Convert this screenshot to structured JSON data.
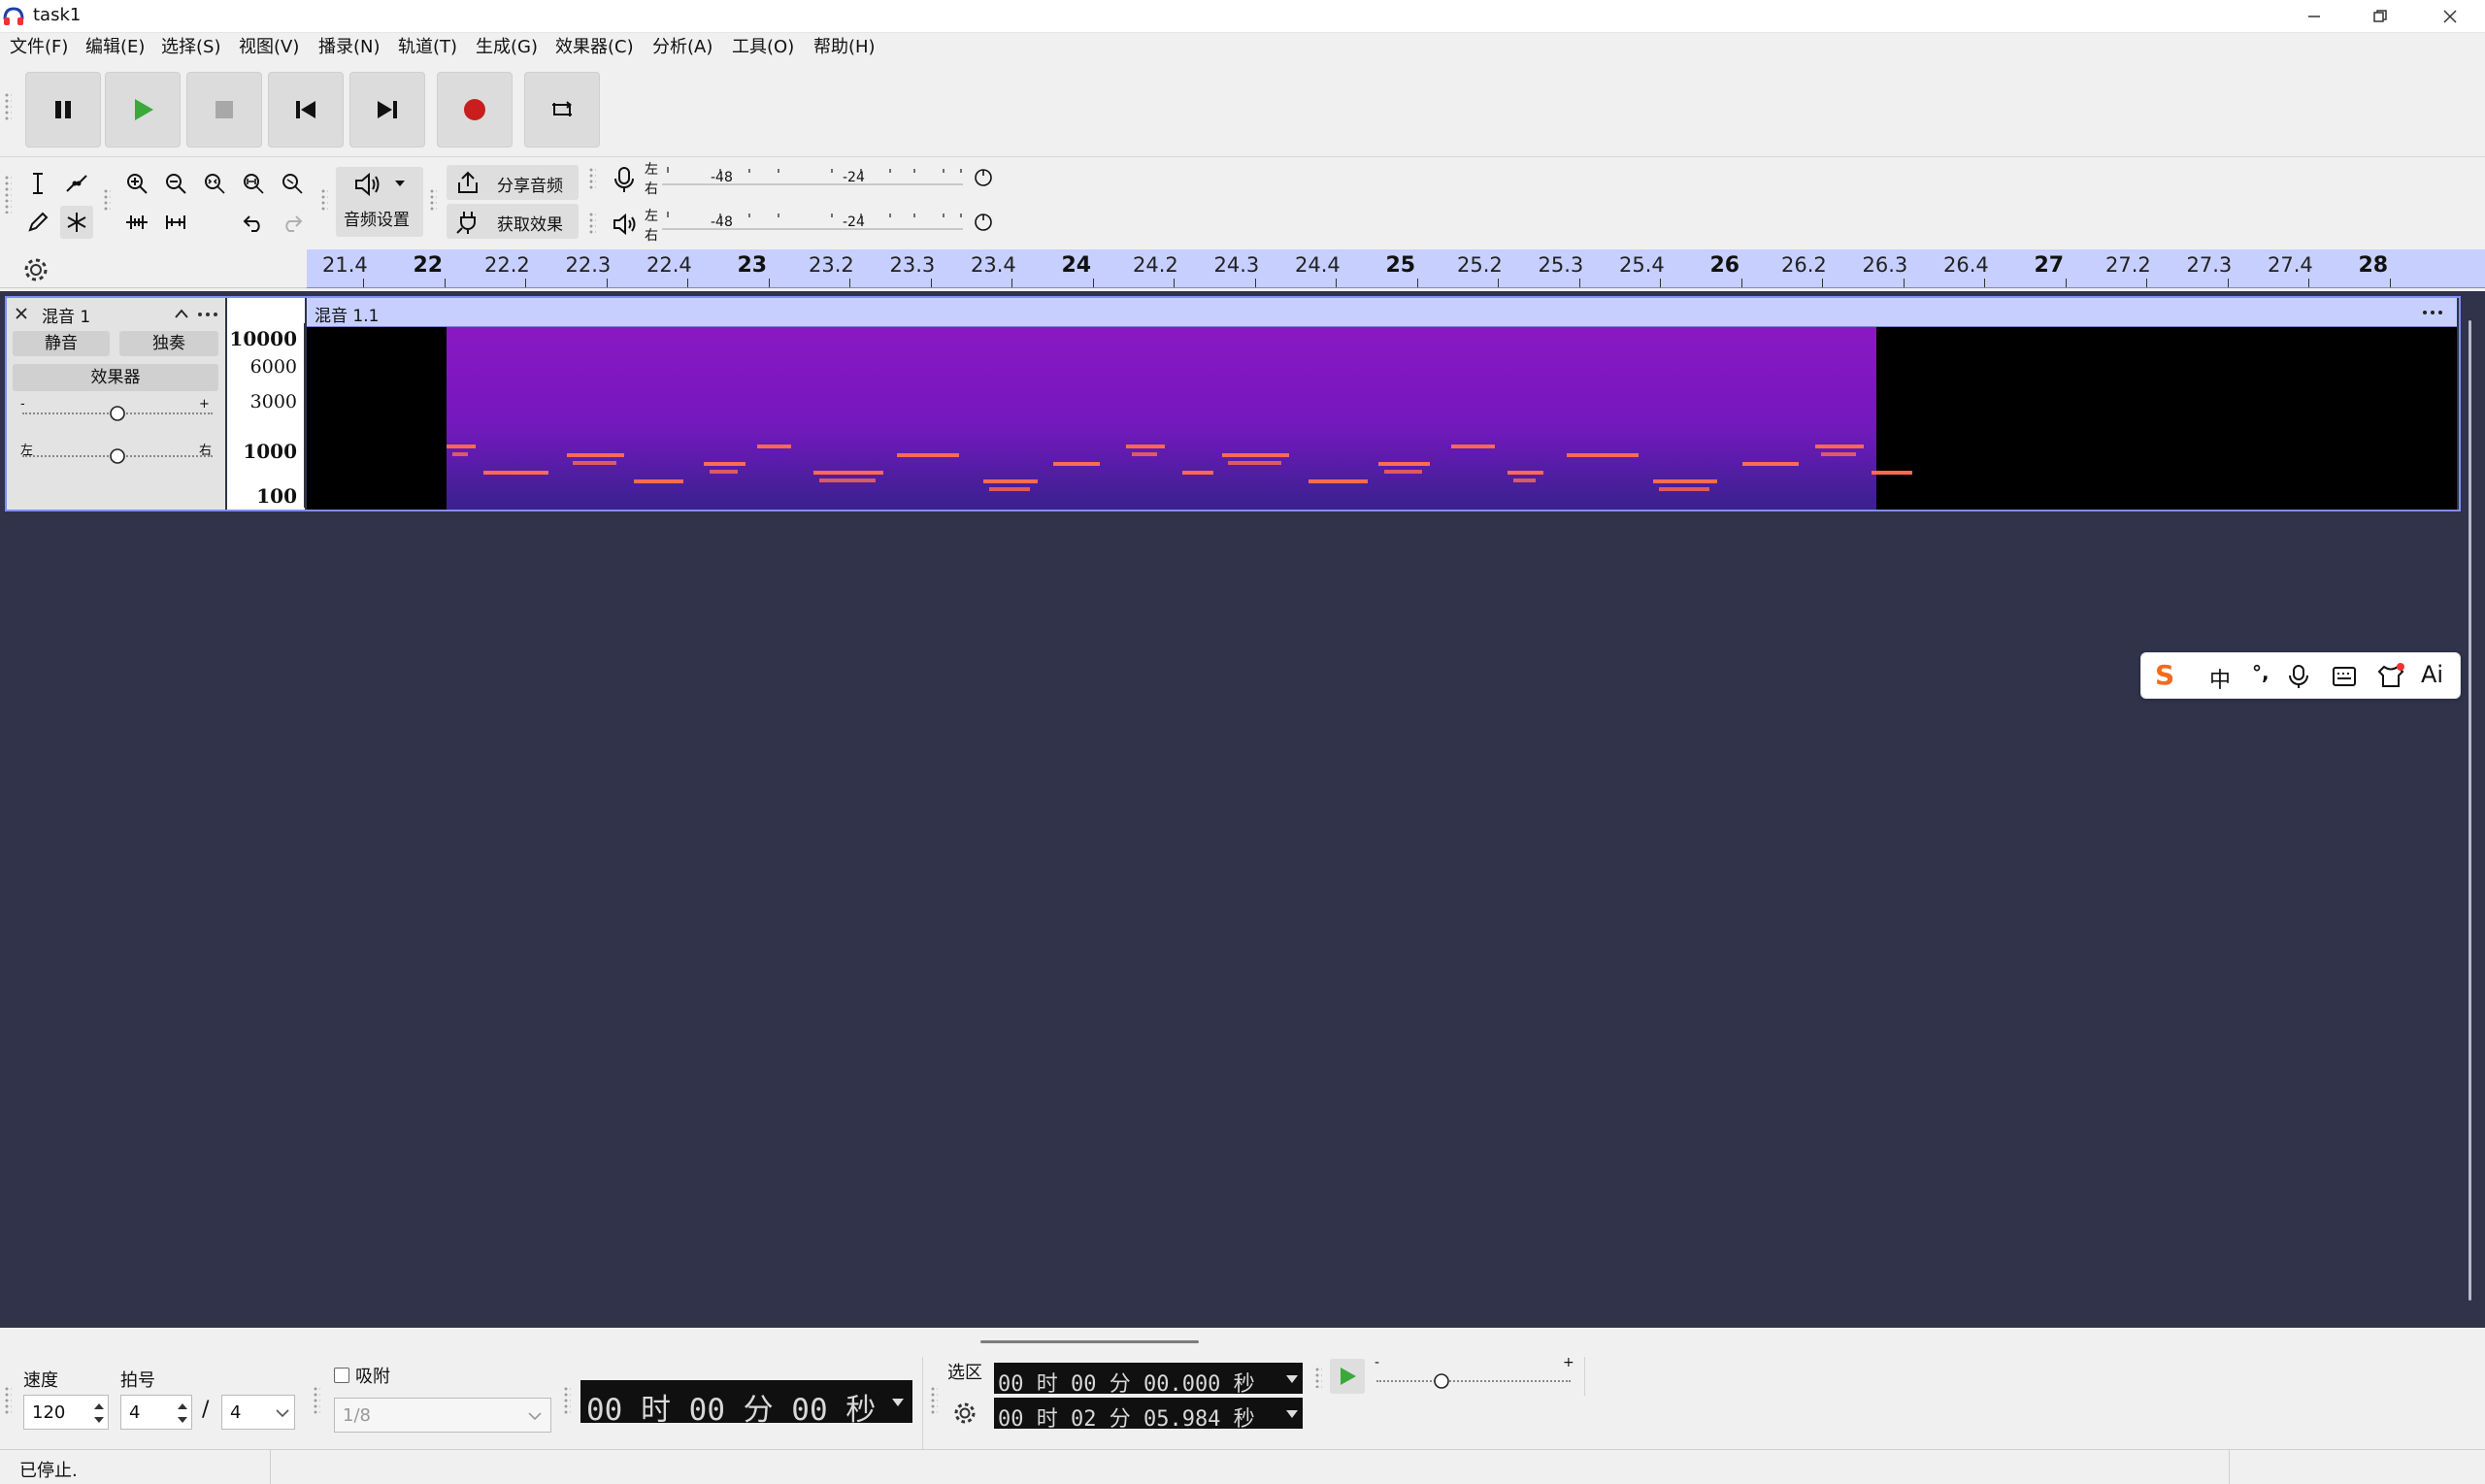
{
  "window": {
    "title": "task1",
    "controls": [
      "minimize-icon",
      "restore-icon",
      "close-icon"
    ]
  },
  "menu": [
    "文件(F)",
    "编辑(E)",
    "选择(S)",
    "视图(V)",
    "播录(N)",
    "轨道(T)",
    "生成(G)",
    "效果器(C)",
    "分析(A)",
    "工具(O)",
    "帮助(H)"
  ],
  "toolbar": {
    "share_audio": "分享音频",
    "get_effects": "获取效果",
    "audio_settings": "音频设置",
    "record_meter": {
      "left": "左",
      "right": "右",
      "ticks": [
        "-48",
        "-24"
      ]
    },
    "play_meter": {
      "left": "左",
      "right": "右",
      "ticks": [
        "-48",
        "-24"
      ]
    }
  },
  "ruler": {
    "labels": [
      "21.4",
      "22",
      "22.2",
      "22.3",
      "22.4",
      "23",
      "23.2",
      "23.3",
      "23.4",
      "24",
      "24.2",
      "24.3",
      "24.4",
      "25",
      "25.2",
      "25.3",
      "25.4",
      "26",
      "26.2",
      "26.3",
      "26.4",
      "27",
      "27.2",
      "27.3",
      "27.4",
      "28"
    ],
    "major": [
      "22",
      "23",
      "24",
      "25",
      "26",
      "27",
      "28"
    ]
  },
  "track": {
    "name": "混音 1",
    "mute": "静音",
    "solo": "独奏",
    "effects": "效果器",
    "gain_minus": "-",
    "gain_plus": "+",
    "pan_left": "左",
    "pan_right": "右",
    "gain_level": 0.5,
    "pan_level": 0.5,
    "freq_labels": [
      "10000",
      "6000",
      "3000",
      "1000",
      "100"
    ],
    "clip_title": "混音 1.1"
  },
  "bottom": {
    "tempo_label": "速度",
    "tempo_value": "120",
    "meter_label": "拍号",
    "meter_num": "4",
    "meter_sep": "/",
    "meter_den": "4",
    "snap_label": "吸附",
    "snap_value": "1/8",
    "time_display": "00 时 00 分 00 秒",
    "selection_label": "选区",
    "sel_start": "00 时 00 分 00.000 秒",
    "sel_end": "00 时 02 分 05.984 秒",
    "play_speed_minus": "-",
    "play_speed_plus": "+"
  },
  "status": "已停止.",
  "ime": {
    "items": [
      "S",
      "中",
      "°,",
      "mic-icon",
      "keyboard-icon",
      "shirt-icon",
      "Ai"
    ]
  },
  "colors": {
    "accent": "#7f8ef2",
    "ruler": "#c6cfff",
    "track_bg": "#30334a",
    "record": "#c81e1e",
    "play": "#3aa83a"
  }
}
